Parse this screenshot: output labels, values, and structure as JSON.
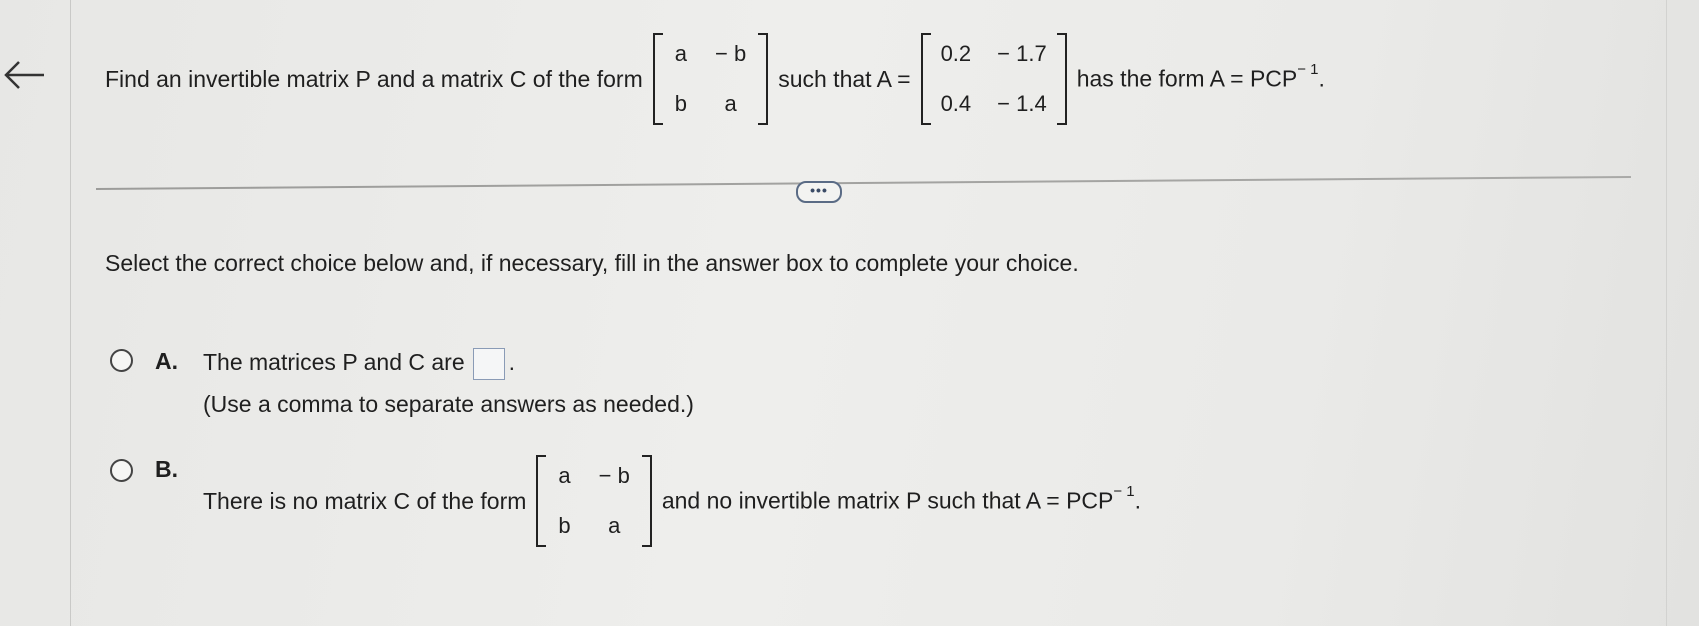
{
  "question": {
    "prefix": "Find an invertible matrix P and a matrix C of the form",
    "matrix_c": [
      "a",
      "− b",
      "b",
      "a"
    ],
    "middle": "such that A =",
    "matrix_a": [
      "0.2",
      "− 1.7",
      "0.4",
      "− 1.4"
    ],
    "suffix": "has the form A = PCP",
    "superscript": "− 1",
    "period": "."
  },
  "more_button_label": "•••",
  "instruction": "Select the correct choice below and, if necessary, fill in the answer box to complete your choice.",
  "choice_a": {
    "letter": "A.",
    "text": "The matrices P and C are",
    "after_box": ".",
    "hint": "(Use a comma to separate answers as needed.)"
  },
  "choice_b": {
    "letter": "B.",
    "prefix": "There is no matrix C of the form",
    "matrix": [
      "a",
      "− b",
      "b",
      "a"
    ],
    "suffix": "and no invertible matrix P such that A = PCP",
    "superscript": "− 1",
    "period": "."
  },
  "icons": {
    "back": "left-arrow-icon"
  }
}
